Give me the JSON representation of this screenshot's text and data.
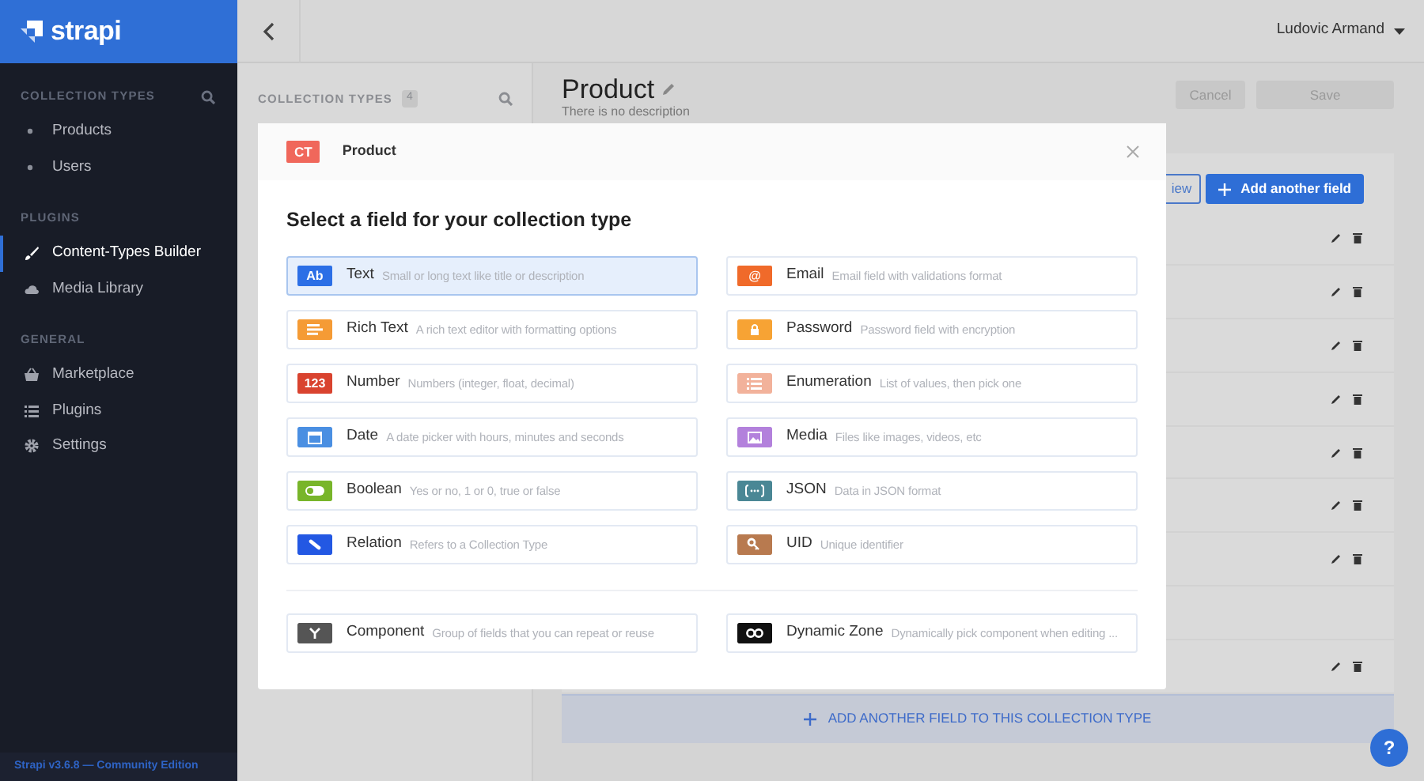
{
  "sidebar": {
    "logo": "strapi",
    "sections": [
      {
        "title": "COLLECTION TYPES",
        "searchable": true,
        "items": [
          {
            "label": "Products",
            "kind": "bullet",
            "selected": false
          },
          {
            "label": "Users",
            "kind": "bullet",
            "selected": false
          }
        ]
      },
      {
        "title": "PLUGINS",
        "searchable": false,
        "items": [
          {
            "label": "Content-Types Builder",
            "kind": "brush",
            "selected": true
          },
          {
            "label": "Media Library",
            "kind": "cloud",
            "selected": false
          }
        ]
      },
      {
        "title": "GENERAL",
        "searchable": false,
        "items": [
          {
            "label": "Marketplace",
            "kind": "basket",
            "selected": false
          },
          {
            "label": "Plugins",
            "kind": "list",
            "selected": false
          },
          {
            "label": "Settings",
            "kind": "gear",
            "selected": false
          }
        ]
      }
    ],
    "footer": "Strapi v3.6.8 — Community Edition"
  },
  "topbar": {
    "user": "Ludovic Armand"
  },
  "collection_panel": {
    "title": "COLLECTION TYPES",
    "count": "4"
  },
  "page": {
    "title": "Product",
    "description": "There is no description",
    "buttons": [
      "Cancel",
      "Save"
    ],
    "toolbar_buttons": [
      {
        "label": "iew",
        "kind": "outline"
      },
      {
        "label": "Add another field",
        "kind": "primary"
      }
    ],
    "add_field_bar": "ADD ANOTHER FIELD TO THIS COLLECTION TYPE"
  },
  "modal": {
    "badge": "CT",
    "title": "Product",
    "heading": "Select a field for your collection type",
    "fields": [
      {
        "kind": "text",
        "glyph": "Ab",
        "label": "Text",
        "description": "Small or long text like title or description",
        "color": "#2c6fe6",
        "selected": true
      },
      {
        "kind": "email",
        "glyph": "@",
        "label": "Email",
        "description": "Email field with validations format",
        "color": "#f06a2a",
        "selected": false
      },
      {
        "kind": "richtext",
        "label": "Rich Text",
        "description": "A rich text editor with formatting options",
        "color": "#f59b35",
        "selected": false
      },
      {
        "kind": "password",
        "label": "Password",
        "description": "Password field with encryption",
        "color": "#f7a334",
        "selected": false
      },
      {
        "kind": "number",
        "glyph": "123",
        "label": "Number",
        "description": "Numbers (integer, float, decimal)",
        "color": "#d9432f",
        "selected": false
      },
      {
        "kind": "enumeration",
        "label": "Enumeration",
        "description": "List of values, then pick one",
        "color": "#f2b29b",
        "selected": false
      },
      {
        "kind": "date",
        "label": "Date",
        "description": "A date picker with hours, minutes and seconds",
        "color": "#4a8fe2",
        "selected": false
      },
      {
        "kind": "media",
        "label": "Media",
        "description": "Files like images, videos, etc",
        "color": "#b381dc",
        "selected": false
      },
      {
        "kind": "boolean",
        "label": "Boolean",
        "description": "Yes or no, 1 or 0, true or false",
        "color": "#78b52a",
        "selected": false
      },
      {
        "kind": "json",
        "label": "JSON",
        "description": "Data in JSON format",
        "color": "#4a8795",
        "selected": false
      },
      {
        "kind": "relation",
        "label": "Relation",
        "description": "Refers to a Collection Type",
        "color": "#2358e3",
        "selected": false
      },
      {
        "kind": "uid",
        "label": "UID",
        "description": "Unique identifier",
        "color": "#b87a4f",
        "selected": false
      }
    ],
    "extra_fields": [
      {
        "kind": "component",
        "label": "Component",
        "description": "Group of fields that you can repeat or reuse",
        "color": "#555555",
        "selected": false
      },
      {
        "kind": "dynamiczone",
        "label": "Dynamic Zone",
        "description": "Dynamically pick component when editing ...",
        "color": "#111111",
        "selected": false
      }
    ]
  },
  "help": "?"
}
